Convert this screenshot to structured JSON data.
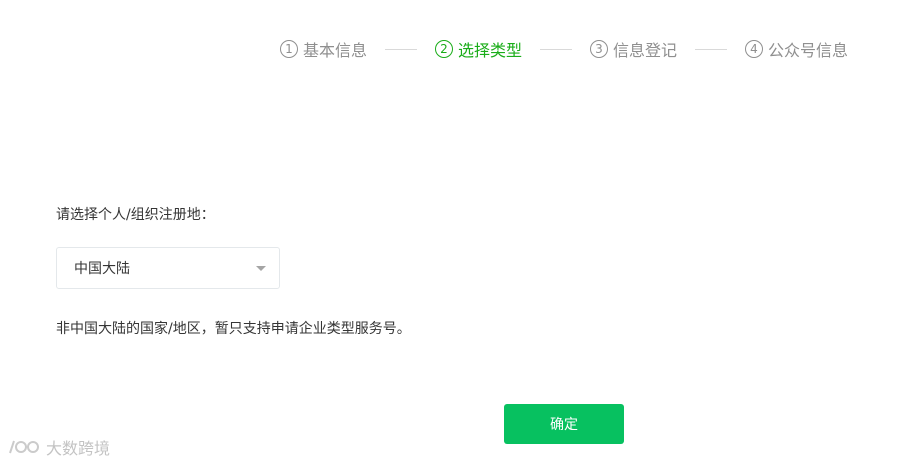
{
  "steps": [
    {
      "num": "1",
      "label": "基本信息",
      "active": false
    },
    {
      "num": "2",
      "label": "选择类型",
      "active": true
    },
    {
      "num": "3",
      "label": "信息登记",
      "active": false
    },
    {
      "num": "4",
      "label": "公众号信息",
      "active": false
    }
  ],
  "form": {
    "prompt": "请选择个人/组织注册地：",
    "region_select": {
      "value": "中国大陆"
    },
    "note": "非中国大陆的国家/地区，暂只支持申请企业类型服务号。"
  },
  "actions": {
    "confirm_label": "确定"
  },
  "watermark": {
    "text": "大数跨境"
  },
  "colors": {
    "accent": "#07c160",
    "active_step": "#1aad19",
    "muted": "#8f8f8f"
  }
}
